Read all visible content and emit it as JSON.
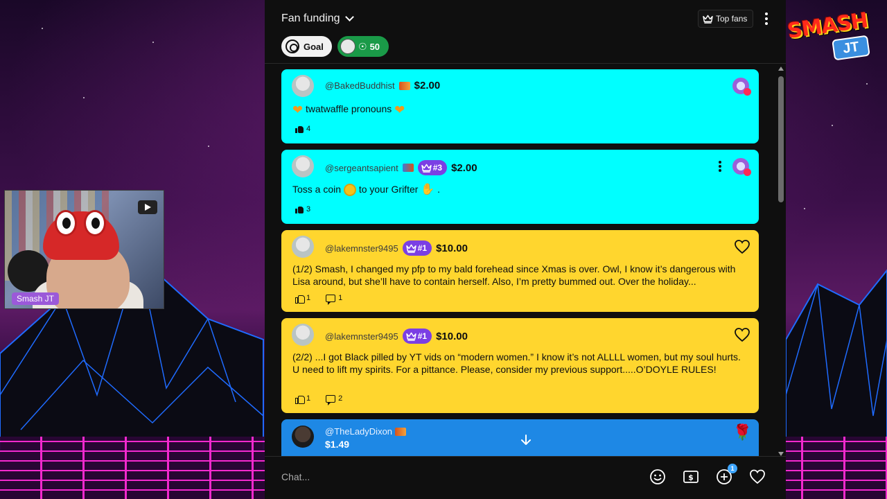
{
  "overlay": {
    "webcam_label": "Smash JT",
    "logo_text": "SMASH",
    "logo_sub": "JT"
  },
  "header": {
    "title": "Fan funding",
    "top_fans_label": "Top fans",
    "chips": [
      {
        "label": "Goal"
      },
      {
        "label": "50"
      }
    ]
  },
  "messages": [
    {
      "handle": "@BakedBuddhist",
      "amount": "$2.00",
      "text_a": "twatwaffle pronouns",
      "likes": "4",
      "color": "#00ffff"
    },
    {
      "handle": "@sergeantsapient",
      "rank": "#3",
      "amount": "$2.00",
      "text_a": "Toss a coin",
      "text_b": "to your Grifter",
      "text_c": ".",
      "likes": "3",
      "color": "#00ffff"
    },
    {
      "handle": "@lakemnster9495",
      "rank": "#1",
      "amount": "$10.00",
      "text": "(1/2) Smash, I changed my pfp to my bald forehead since Xmas is over. Owl, I know it’s dangerous with Lisa around, but she’ll have to contain herself. Also, I’m pretty bummed out. Over the holiday...",
      "likes": "1",
      "replies": "1",
      "color": "#ffd62e"
    },
    {
      "handle": "@lakemnster9495",
      "rank": "#1",
      "amount": "$10.00",
      "text": "(2/2) ...I got Black pilled by YT vids on “modern women.” I know it’s not ALLLL women, but my soul hurts. U need to lift my spirits. For a pittance. Please, consider my previous support.....O’DOYLE RULES!",
      "likes": "1",
      "replies": "2",
      "color": "#ffd62e"
    },
    {
      "handle": "@TheLadyDixon",
      "amount": "$1.49",
      "color": "#1e88e5"
    }
  ],
  "chat_bar": {
    "placeholder": "Chat...",
    "notification_count": "1"
  }
}
